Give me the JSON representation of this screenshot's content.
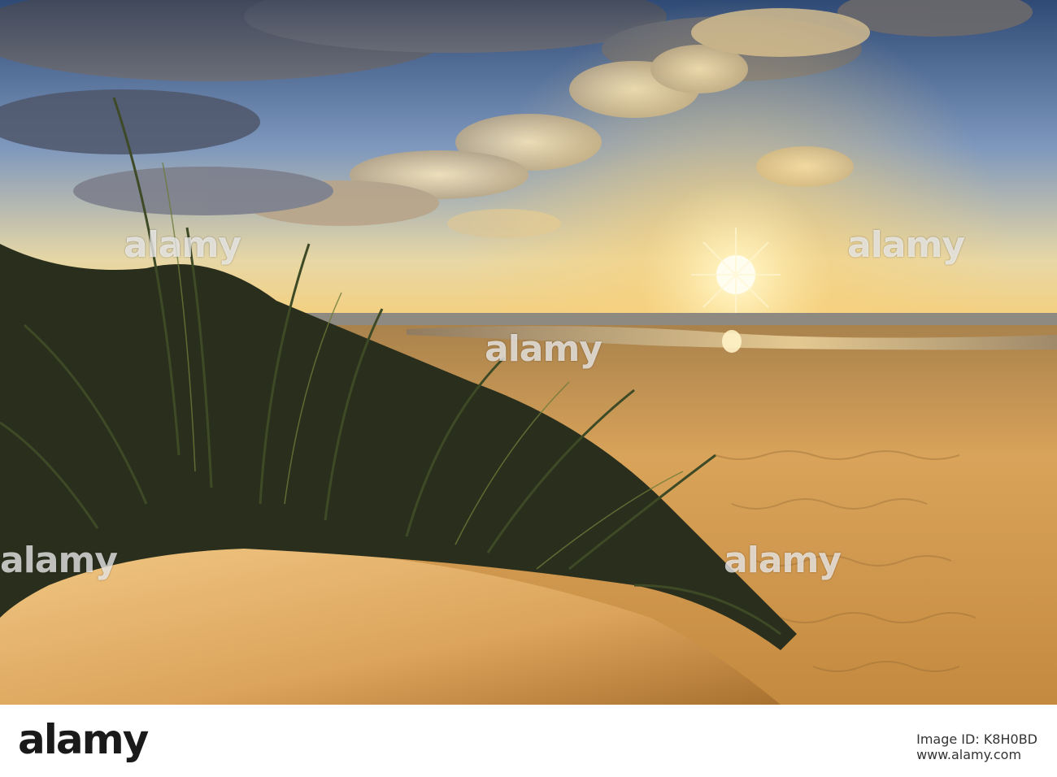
{
  "photo": {
    "subject": "sunset over sandy beach with dune grass",
    "colors": {
      "sky_top": "#3d5a86",
      "sky_mid": "#8fa6c6",
      "horizon_glow": "#f7d27a",
      "sun": "#fff6d2",
      "sand_light": "#e8b86a",
      "sand_dark": "#7a5426",
      "grass": "#2f3a20"
    }
  },
  "watermarks": [
    "alamy",
    "alamy",
    "alamy",
    "alamy",
    "alamy"
  ],
  "footer": {
    "brand": "alamy",
    "image_id_label": "Image ID: ",
    "image_id": "K8H0BD",
    "site": "www.alamy.com"
  }
}
